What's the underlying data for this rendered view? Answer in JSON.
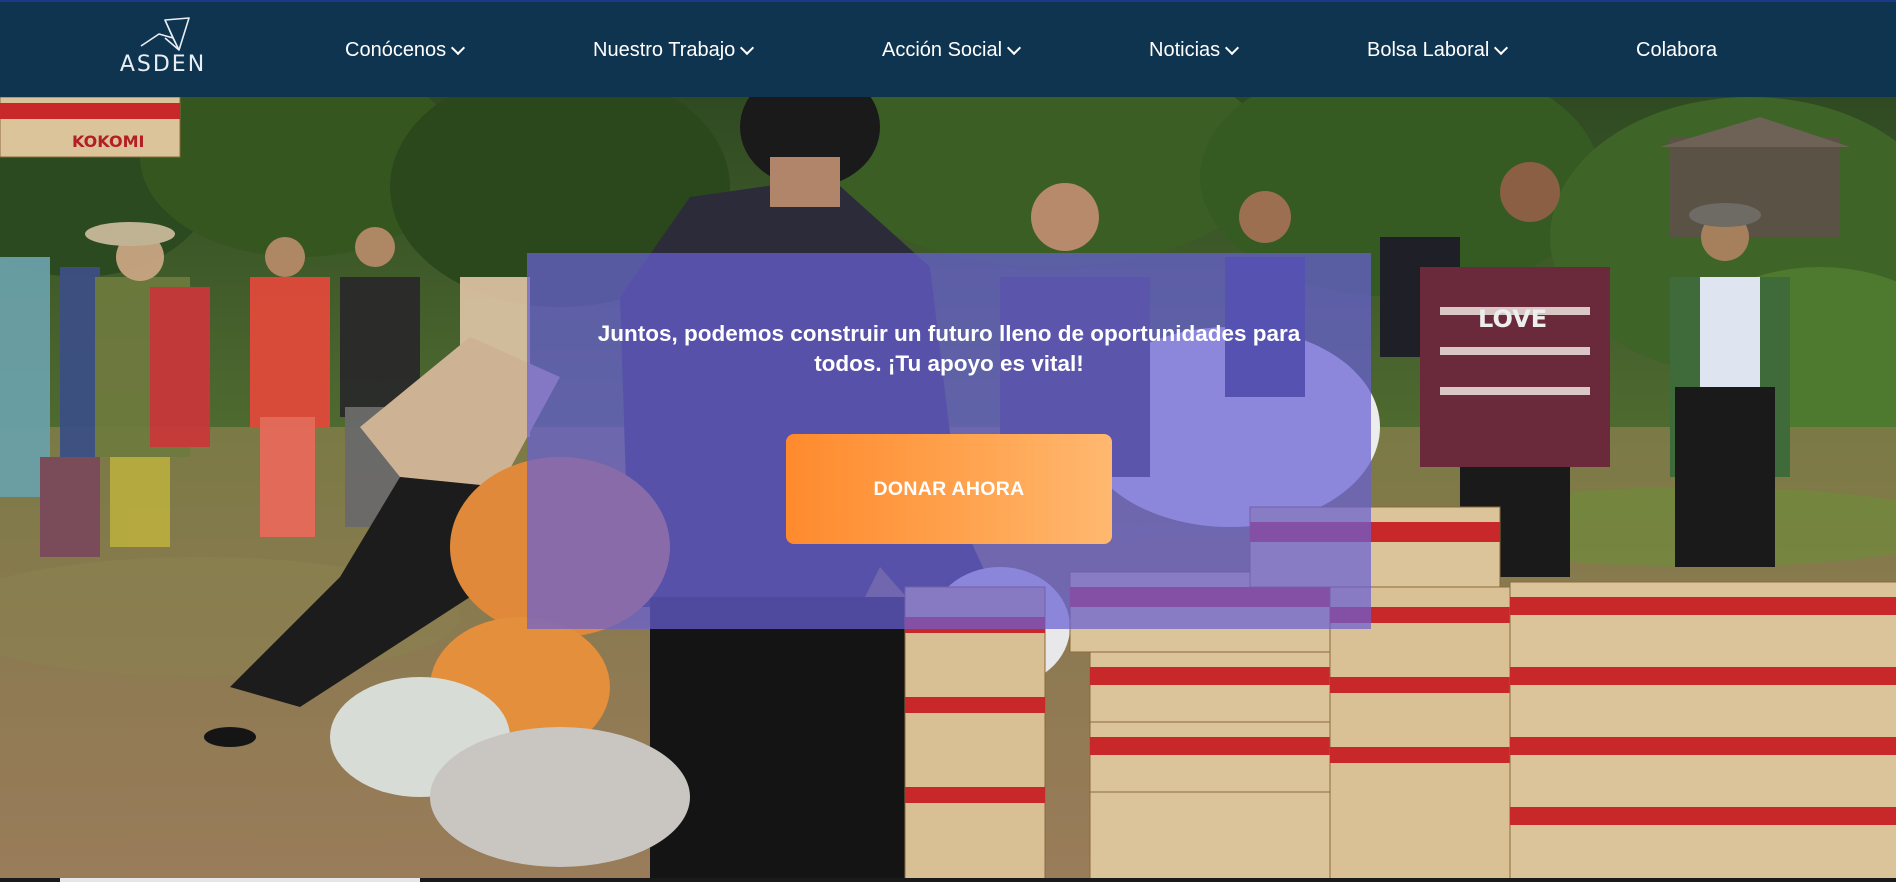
{
  "brand": {
    "name": "ASDEN",
    "logo_icon": "bird-origami-icon"
  },
  "nav": {
    "items": [
      {
        "label": "Conócenos",
        "has_dropdown": true
      },
      {
        "label": "Nuestro Trabajo",
        "has_dropdown": true
      },
      {
        "label": "Acción Social",
        "has_dropdown": true
      },
      {
        "label": "Noticias",
        "has_dropdown": true
      },
      {
        "label": "Bolsa Laboral",
        "has_dropdown": true
      },
      {
        "label": "Colabora",
        "has_dropdown": false
      }
    ]
  },
  "hero": {
    "message": "Juntos, podemos construir un futuro lleno de oportunidades para todos. ¡Tu apoyo es vital!",
    "cta_label": "DONAR AHORA",
    "image_description": "food-aid-distribution-photo",
    "box_brand": "KOKOMI",
    "shirt_text": "LOVE"
  },
  "colors": {
    "nav_background": "#0f3450",
    "overlay": "#6860d6",
    "cta_gradient_start": "#ff8a2d",
    "cta_gradient_end": "#ffb870"
  }
}
